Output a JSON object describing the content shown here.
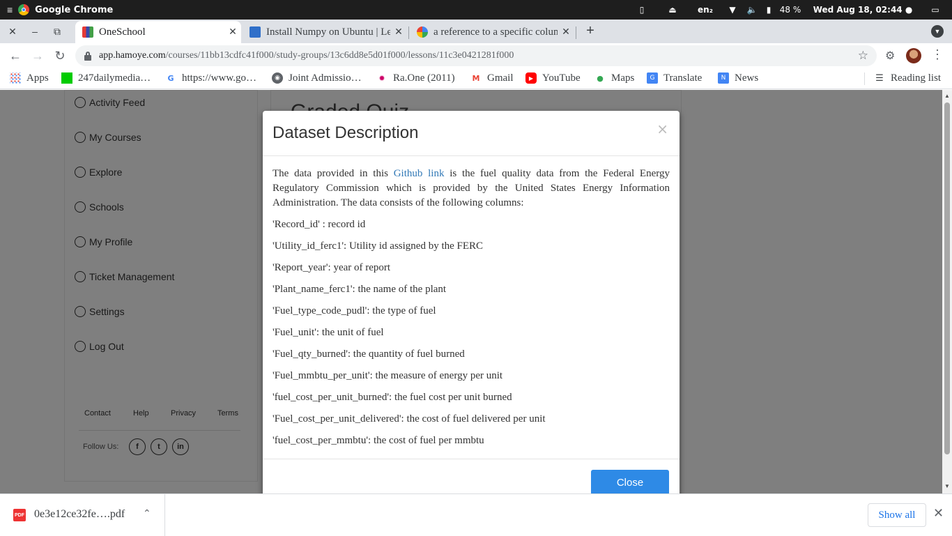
{
  "os": {
    "app_name": "Google Chrome",
    "lang": "en₂",
    "battery": "48 %",
    "datetime": "Wed Aug 18, 02:44 ●"
  },
  "tabs": [
    {
      "label": "OneSchool",
      "close": "✕",
      "active": true
    },
    {
      "label": "Install Numpy on Ubuntu | Lea",
      "close": "✕",
      "active": false
    },
    {
      "label": "a reference to a specific colum",
      "close": "✕",
      "active": false
    }
  ],
  "address": {
    "host": "app.hamoye.com",
    "path": "/courses/11bb13cdfc41f000/study-groups/13c6dd8e5d01f000/lessons/11c3e0421281f000"
  },
  "bookmarks": [
    {
      "label": "Apps",
      "icon": "apps-grid-icon"
    },
    {
      "label": "247dailymedia…",
      "icon": "green-square-icon"
    },
    {
      "label": "https://www.go…",
      "icon": "google-icon"
    },
    {
      "label": "Joint Admissio…",
      "icon": "globe-icon"
    },
    {
      "label": "Ra.One (2011)",
      "icon": "starburst-icon"
    },
    {
      "label": "Gmail",
      "icon": "gmail-icon"
    },
    {
      "label": "YouTube",
      "icon": "youtube-icon"
    },
    {
      "label": "Maps",
      "icon": "maps-pin-icon"
    },
    {
      "label": "Translate",
      "icon": "translate-icon"
    },
    {
      "label": "News",
      "icon": "news-icon"
    }
  ],
  "reading_list": "Reading list",
  "sidebar": {
    "items": [
      "Activity Feed",
      "My Courses",
      "Explore",
      "Schools",
      "My Profile",
      "Ticket Management",
      "Settings",
      "Log Out"
    ],
    "footer_links": [
      "Contact",
      "Help",
      "Privacy",
      "Terms"
    ],
    "follow_label": "Follow Us:",
    "social": [
      "f",
      "t",
      "in"
    ]
  },
  "main": {
    "title": "Graded Quiz"
  },
  "modal": {
    "title": "Dataset Description",
    "close_x": "×",
    "intro_before": "The data provided in this ",
    "intro_link": "Github link",
    "intro_after": " is the fuel quality data from the Federal Energy Regulatory Commission which is provided by the United States Energy Information Administration. The data consists of the following columns:",
    "columns": [
      "'Record_id' : record id",
      "'Utility_id_ferc1': Utility id assigned by the FERC",
      "'Report_year': year of report",
      "'Plant_name_ferc1': the name of the plant",
      "'Fuel_type_code_pudl': the type of fuel",
      "'Fuel_unit': the unit of fuel",
      "'Fuel_qty_burned': the quantity of fuel burned",
      "'Fuel_mmbtu_per_unit': the measure of energy per unit",
      "'fuel_cost_per_unit_burned': the fuel cost per unit burned",
      "'Fuel_cost_per_unit_delivered': the cost of fuel delivered per unit",
      "'fuel_cost_per_mmbtu': the cost of fuel per mmbtu"
    ],
    "close_button": "Close"
  },
  "downloads": {
    "file_name": "0e3e12ce32fe….pdf",
    "file_badge": "PDF",
    "show_all": "Show all"
  },
  "colors": {
    "primary_button": "#2e8ae6",
    "link": "#337ab7",
    "os_bar": "#1e1e1e"
  }
}
